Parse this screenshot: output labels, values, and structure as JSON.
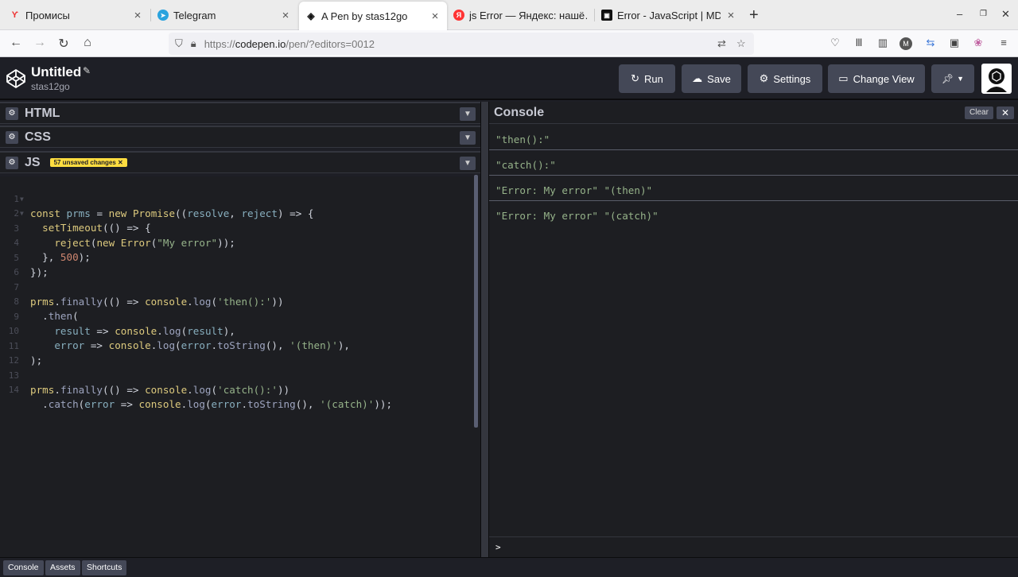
{
  "browser": {
    "tabs": [
      {
        "title": "Промисы",
        "favicon": "ya-icon",
        "favicon_glyph": "Ƴ",
        "favicon_color": "#e33"
      },
      {
        "title": "Telegram",
        "favicon": "telegram-icon",
        "favicon_glyph": "➤",
        "favicon_color": "#2aa3de"
      },
      {
        "title": "A Pen by stas12go",
        "favicon": "codepen-icon",
        "favicon_glyph": "◈",
        "favicon_color": "#111"
      },
      {
        "title": "js Error — Яндекс: нашё…",
        "favicon": "yandex-icon",
        "favicon_glyph": "Я",
        "favicon_color": "#f33"
      },
      {
        "title": "Error - JavaScript | MDN",
        "favicon": "mdn-icon",
        "favicon_glyph": "▣",
        "favicon_color": "#111"
      }
    ],
    "url_prefix": "https://",
    "url_host": "codepen.io",
    "url_path": "/pen/?editors=0012"
  },
  "header": {
    "title": "Untitled",
    "user": "stas12go",
    "run_label": "Run",
    "save_label": "Save",
    "settings_label": "Settings",
    "change_view_label": "Change View"
  },
  "editors": {
    "html_label": "HTML",
    "css_label": "CSS",
    "js_label": "JS",
    "unsaved_badge": "57 unsaved changes ✕",
    "line_numbers": [
      "1",
      "2",
      "3",
      "4",
      "5",
      "6",
      "7",
      "8",
      "9",
      "10",
      "11",
      "12",
      "13",
      "14"
    ]
  },
  "console": {
    "title": "Console",
    "clear_label": "Clear",
    "close_label": "✕",
    "messages": [
      "\"then():\"",
      "\"catch():\"",
      "\"Error: My error\" \"(then)\"",
      "\"Error: My error\" \"(catch)\""
    ],
    "prompt": ">"
  },
  "footer": {
    "console_label": "Console",
    "assets_label": "Assets",
    "shortcuts_label": "Shortcuts"
  },
  "colors": {
    "accent_yellow": "#ffdd40",
    "button_bg": "#444857",
    "console_string": "#96b38a"
  }
}
